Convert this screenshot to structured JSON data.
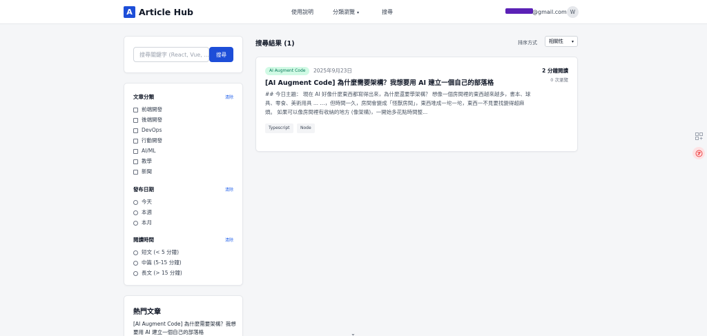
{
  "header": {
    "logo_letter": "A",
    "brand": "Article Hub",
    "nav": [
      "使用說明",
      "分類瀏覽",
      "搜尋"
    ],
    "email_suffix": "@gmail.com",
    "avatar_letter": "W"
  },
  "search": {
    "placeholder": "搜尋關鍵字 (React, Vue, ...",
    "button_label": "搜尋"
  },
  "filters": {
    "category": {
      "title": "文章分類",
      "clear": "清除",
      "options": [
        "前端開發",
        "後端開發",
        "DevOps",
        "行動開發",
        "AI/ML",
        "教學",
        "新聞"
      ]
    },
    "date": {
      "title": "發布日期",
      "clear": "清除",
      "options": [
        "今天",
        "本週",
        "本月"
      ]
    },
    "reading_time": {
      "title": "閱讀時間",
      "clear": "清除",
      "options": [
        "短文 (< 5 分鐘)",
        "中篇 (5-15 分鐘)",
        "長文 (> 15 分鐘)"
      ]
    }
  },
  "hot": {
    "title": "熱門文章",
    "items": [
      "[AI Augment Code] 為什麼需要架構？我想要用 AI 建立一個自己的部落格"
    ]
  },
  "results": {
    "title": "搜尋結果 (1)",
    "sort_label": "排序方式",
    "sort_value": "相關性"
  },
  "article": {
    "badge": "AI Augment Code",
    "date": "2025年9月23日",
    "title": "[AI Augment Code] 為什麼需要架構？我想要用 AI 建立一個自己的部落格",
    "excerpt": "## 今日主題： 現在 AI 好像什麼東西都寫得出來，為什麼還要學架構？ 想像一個房間裡的東西越來越多，書本、球具、零食、美術用具 ... ...，但時間一久，房間會變成「怪獸房間」，東西堆成一坨一坨，東西一不見要找變得超麻煩。 如果可以像房間裡有收納的地方 (像架構)，一開始多花點時間整...",
    "read_time": "2 分鐘閱讀",
    "views": "0 次瀏覽",
    "tags": [
      "Typescript",
      "Node"
    ]
  },
  "colors": {
    "primary": "#1d4ed8",
    "badge_bg": "#d1fae5",
    "badge_text": "#047857",
    "redaction": "#5b21b6"
  }
}
